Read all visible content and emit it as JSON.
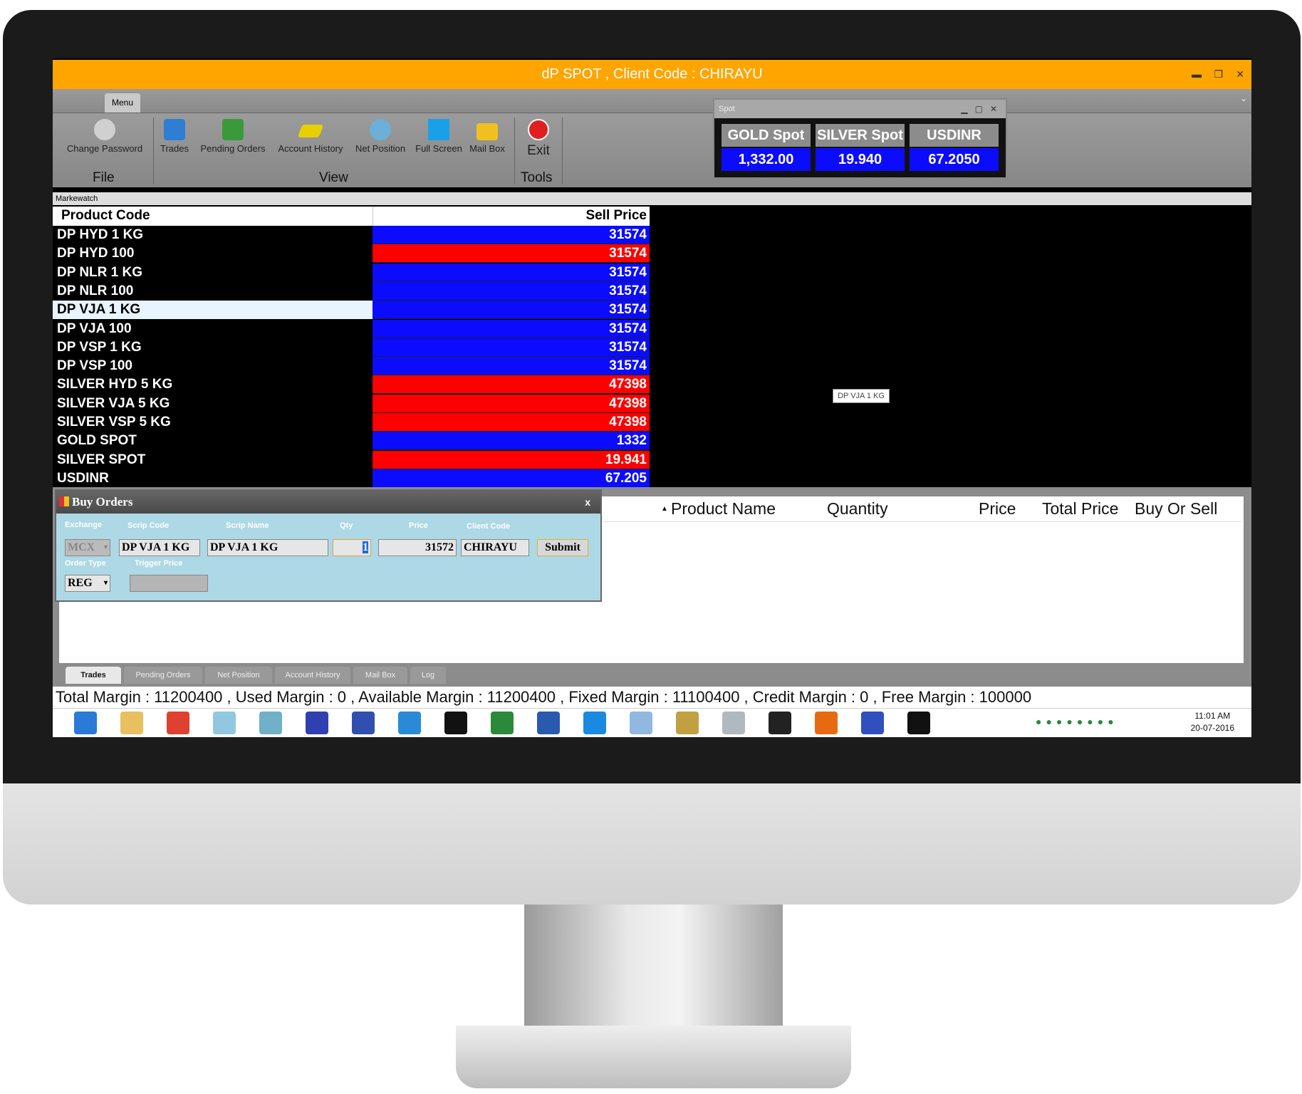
{
  "window": {
    "title": "dP SPOT , Client Code : CHIRAYU",
    "minimize": "▬",
    "restore": "❐",
    "close": "✕"
  },
  "ribbon": {
    "tab": "Menu",
    "groups": {
      "file": "File",
      "view": "View",
      "tools": "Tools"
    },
    "buttons": [
      {
        "label": "Change Password",
        "icon": "key-icon",
        "color": "#d0d0d0"
      },
      {
        "label": "Trades",
        "icon": "books-icon",
        "color": "#2d7fd4"
      },
      {
        "label": "Pending Orders",
        "icon": "book-icon",
        "color": "#3a9a3a"
      },
      {
        "label": "Account History",
        "icon": "gold-bar-icon",
        "color": "#e8d000"
      },
      {
        "label": "Net Position",
        "icon": "net-position-icon",
        "color": "#6ab0d8"
      },
      {
        "label": "Full Screen",
        "icon": "full-screen-icon",
        "color": "#1aa0e8"
      },
      {
        "label": "Mail Box",
        "icon": "mail-icon",
        "color": "#f0c020"
      }
    ],
    "exit": {
      "label": "Exit",
      "icon": "exit-icon",
      "color": "#e02020"
    }
  },
  "spot": {
    "title": "Spot",
    "items": [
      {
        "name": "GOLD Spot",
        "value": "1,332.00"
      },
      {
        "name": "SILVER Spot",
        "value": "19.940"
      },
      {
        "name": "USDINR",
        "value": "67.2050"
      }
    ]
  },
  "marketwatch": {
    "label": "Markewatch",
    "headers": {
      "product": "Product Code",
      "sell": "Sell Price"
    },
    "rows": [
      {
        "code": "DP HYD 1 KG",
        "price": "31574",
        "color": "#0b0bff"
      },
      {
        "code": "DP HYD 100",
        "price": "31574",
        "color": "#ff0000"
      },
      {
        "code": "DP NLR 1 KG",
        "price": "31574",
        "color": "#0b0bff"
      },
      {
        "code": "DP NLR 100",
        "price": "31574",
        "color": "#0b0bff"
      },
      {
        "code": "DP VJA 1 KG",
        "price": "31574",
        "color": "#0b0bff",
        "selected": true
      },
      {
        "code": "DP VJA 100",
        "price": "31574",
        "color": "#0b0bff"
      },
      {
        "code": "DP VSP 1 KG",
        "price": "31574",
        "color": "#0b0bff"
      },
      {
        "code": "DP VSP 100",
        "price": "31574",
        "color": "#0b0bff"
      },
      {
        "code": "SILVER HYD 5 KG",
        "price": "47398",
        "color": "#ff0000"
      },
      {
        "code": "SILVER VJA 5 KG",
        "price": "47398",
        "color": "#ff0000"
      },
      {
        "code": "SILVER VSP 5 KG",
        "price": "47398",
        "color": "#ff0000"
      },
      {
        "code": "GOLD SPOT",
        "price": "1332",
        "color": "#0b0bff"
      },
      {
        "code": "SILVER SPOT",
        "price": "19.941",
        "color": "#ff0000"
      },
      {
        "code": "USDINR",
        "price": "67.205",
        "color": "#0b0bff"
      }
    ],
    "tooltip": "DP VJA 1 KG"
  },
  "buy_orders": {
    "title": "Buy Orders",
    "close": "x",
    "labels": {
      "exchange": "Exchange",
      "scrip_code": "Scrip Code",
      "scrip_name": "Scrip Name",
      "qty": "Qty",
      "price": "Price",
      "client_code": "Client Code",
      "order_type": "Order Type",
      "trigger_price": "Trigger Price"
    },
    "values": {
      "exchange": "MCX",
      "scrip_code": "DP VJA 1 KG",
      "scrip_name": "DP VJA 1 KG",
      "qty": "1",
      "price": "31572",
      "client_code": "CHIRAYU",
      "order_type": "REG",
      "trigger_price": ""
    },
    "submit": "Submit"
  },
  "trades_grid": {
    "sort_indicator": "▲",
    "headers": [
      "Product Name",
      "Quantity",
      "Price",
      "Total Price",
      "Buy Or Sell"
    ]
  },
  "bottom_tabs": [
    "Trades",
    "Pending Orders",
    "Net Position",
    "Account History",
    "Mail Box",
    "Log"
  ],
  "margin_status": "Total Margin : 11200400 , Used Margin : 0 , Available Margin : 11200400 , Fixed Margin : 11100400 , Credit Margin : 0 , Free Margin : 100000",
  "taskbar": {
    "icons": [
      {
        "name": "network-icon",
        "color": "#2a7ad8"
      },
      {
        "name": "file-explorer-icon",
        "color": "#e8c060"
      },
      {
        "name": "chrome-icon",
        "color": "#e04030"
      },
      {
        "name": "notepad-icon",
        "color": "#90c8e0"
      },
      {
        "name": "buildings-icon",
        "color": "#70b0c8"
      },
      {
        "name": "infinity-icon",
        "color": "#3040b0"
      },
      {
        "name": "computer-icon",
        "color": "#3050b0"
      },
      {
        "name": "card-icon",
        "color": "#2a8ad8"
      },
      {
        "name": "terminal-icon",
        "color": "#111111"
      },
      {
        "name": "excel-icon",
        "color": "#2a8a3a"
      },
      {
        "name": "word-icon",
        "color": "#2a5ab0"
      },
      {
        "name": "teamviewer-icon",
        "color": "#1a8ae0"
      },
      {
        "name": "calculator-icon",
        "color": "#90b8e0"
      },
      {
        "name": "tools-icon",
        "color": "#c0a040"
      },
      {
        "name": "scanner-icon",
        "color": "#b0b8c0"
      },
      {
        "name": "bulb-icon",
        "color": "#222222"
      },
      {
        "name": "firefox-icon",
        "color": "#e86a10"
      },
      {
        "name": "network-connect-icon",
        "color": "#3050c0"
      },
      {
        "name": "sphere-icon",
        "color": "#111111"
      }
    ],
    "time": "11:01 AM",
    "date": "20-07-2016"
  }
}
